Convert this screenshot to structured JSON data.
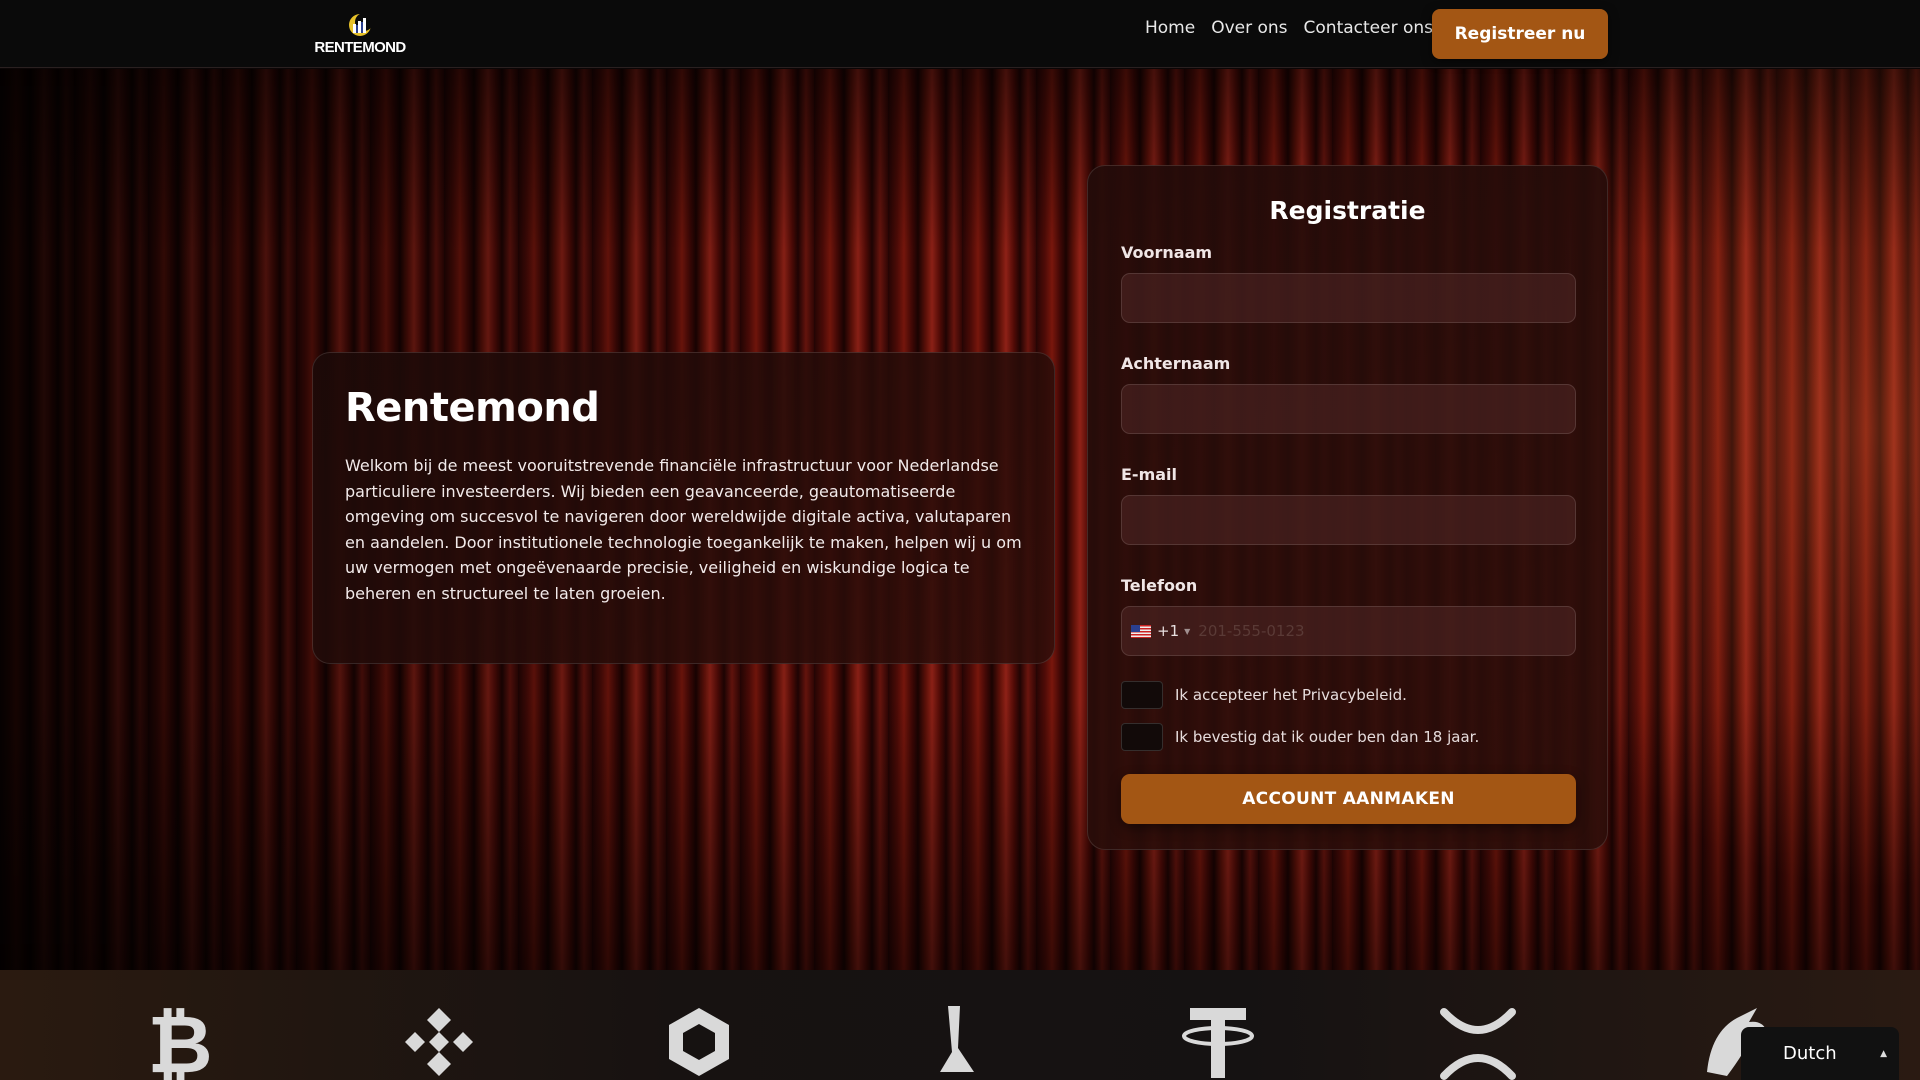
{
  "header": {
    "logo_text": "RENTEMOND",
    "nav": [
      {
        "label": "Home"
      },
      {
        "label": "Over ons"
      },
      {
        "label": "Contacteer ons"
      }
    ],
    "cta_label": "Registreer nu"
  },
  "intro": {
    "title": "Rentemond",
    "text": "Welkom bij de meest vooruitstrevende financiële infrastructuur voor Nederlandse particuliere investeerders. Wij bieden een geavanceerde, geautomatiseerde omgeving om succesvol te navigeren door wereldwijde digitale activa, valutaparen en aandelen. Door institutionele technologie toegankelijk te maken, helpen wij u om uw vermogen met ongeëvenaarde precisie, veiligheid en wiskundige logica te beheren en structureel te laten groeien."
  },
  "registration": {
    "title": "Registratie",
    "first_name_label": "Voornaam",
    "first_name_value": "",
    "last_name_label": "Achternaam",
    "last_name_value": "",
    "email_label": "E-mail",
    "email_value": "",
    "phone_label": "Telefoon",
    "phone_country_code": "+1",
    "phone_placeholder": "201-555-0123",
    "phone_value": "",
    "privacy_label": "Ik accepteer het Privacybeleid.",
    "age_label": "Ik bevestig dat ik ouder ben dan 18 jaar.",
    "submit_label": "ACCOUNT AANMAKEN"
  },
  "ticker": {
    "coins": [
      {
        "icon": "bitcoin-icon"
      },
      {
        "icon": "binance-icon"
      },
      {
        "icon": "chainlink-icon"
      },
      {
        "icon": "lisk-icon"
      },
      {
        "icon": "tether-icon"
      },
      {
        "icon": "xrp-icon"
      },
      {
        "icon": "dragon-coin-icon"
      }
    ]
  },
  "language": {
    "selected": "Dutch"
  },
  "colors": {
    "accent": "#a35614",
    "header_bg": "#0a0a0a",
    "card_bg": "#240c0a"
  }
}
